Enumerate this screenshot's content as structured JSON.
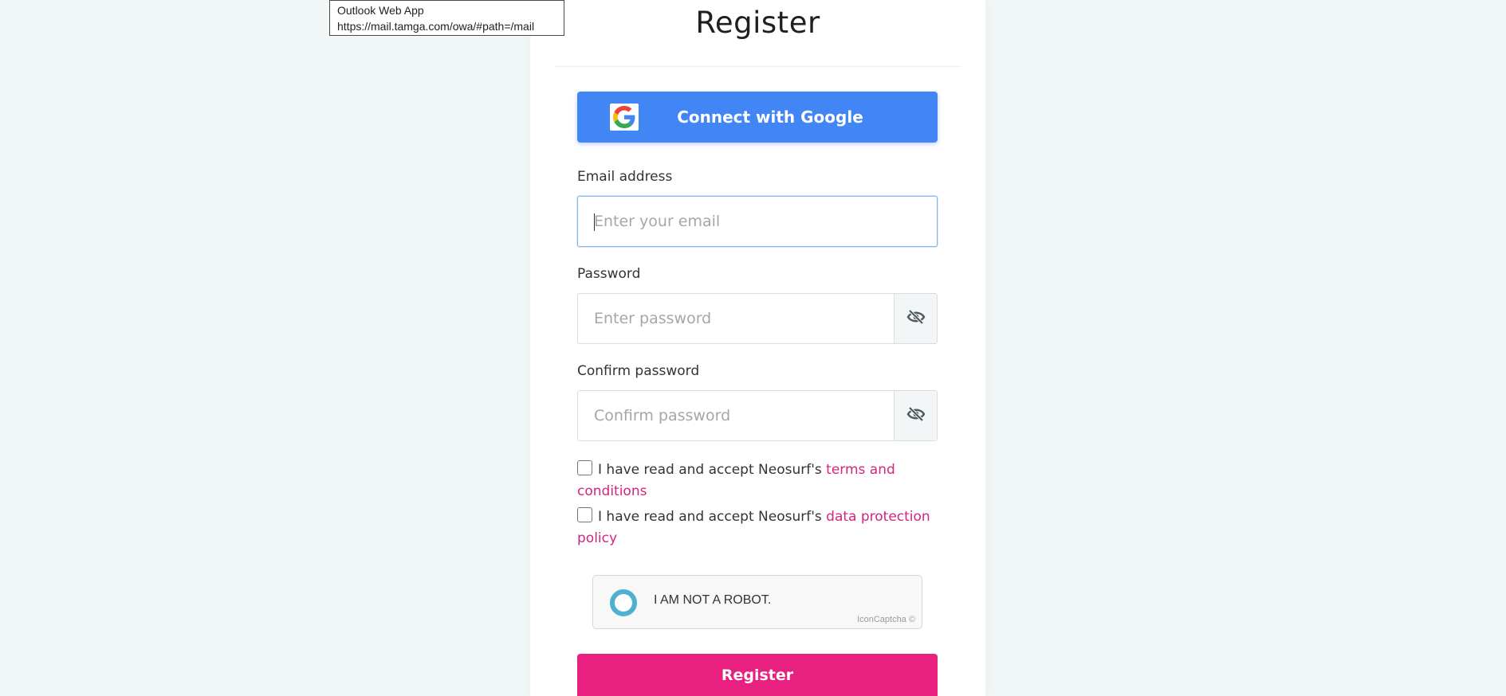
{
  "tooltip": {
    "title": "Outlook Web App",
    "url": "https://mail.tamga.com/owa/#path=/mail"
  },
  "form": {
    "title": "Register",
    "google_button": {
      "label": "Connect with Google",
      "icon": "google-logo-icon"
    },
    "email": {
      "label": "Email address",
      "placeholder": "Enter your email",
      "value": ""
    },
    "password": {
      "label": "Password",
      "placeholder": "Enter password",
      "value": "",
      "toggle_icon": "eye-slash-icon"
    },
    "confirm_password": {
      "label": "Confirm password",
      "placeholder": "Confirm password",
      "value": "",
      "toggle_icon": "eye-slash-icon"
    },
    "terms": {
      "text": "I have read and accept Neosurf's ",
      "link": "terms and conditions",
      "checked": false
    },
    "privacy": {
      "text": "I have read and accept Neosurf's ",
      "link": "data protection policy",
      "checked": false
    },
    "captcha": {
      "label": "I AM NOT A ROBOT.",
      "brand": "IconCaptcha ©"
    },
    "submit_label": "Register"
  },
  "colors": {
    "page_background": "#f1f6f6",
    "google_blue": "#4285f4",
    "brand_pink": "#e8207f",
    "link_pink": "#d32480",
    "captcha_ring": "#4fb0d1"
  }
}
